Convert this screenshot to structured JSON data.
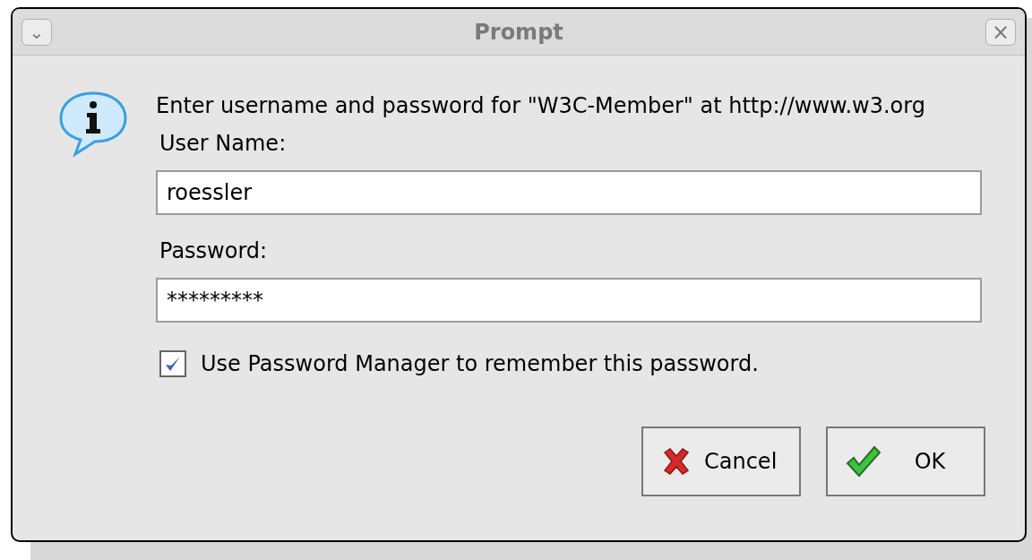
{
  "window": {
    "title": "Prompt",
    "menu_glyph": "⌄",
    "close_glyph": "×"
  },
  "message": "Enter username and password for \"W3C-Member\" at http://www.w3.org",
  "fields": [
    {
      "label": "User Name:",
      "value": "roessler"
    },
    {
      "label": "Password:",
      "value": "*********"
    }
  ],
  "remember": {
    "label": "Use Password Manager to remember this password.",
    "checked": true
  },
  "buttons": [
    {
      "kind": "cancel",
      "label": "Cancel"
    },
    {
      "kind": "ok",
      "label": "OK"
    }
  ]
}
